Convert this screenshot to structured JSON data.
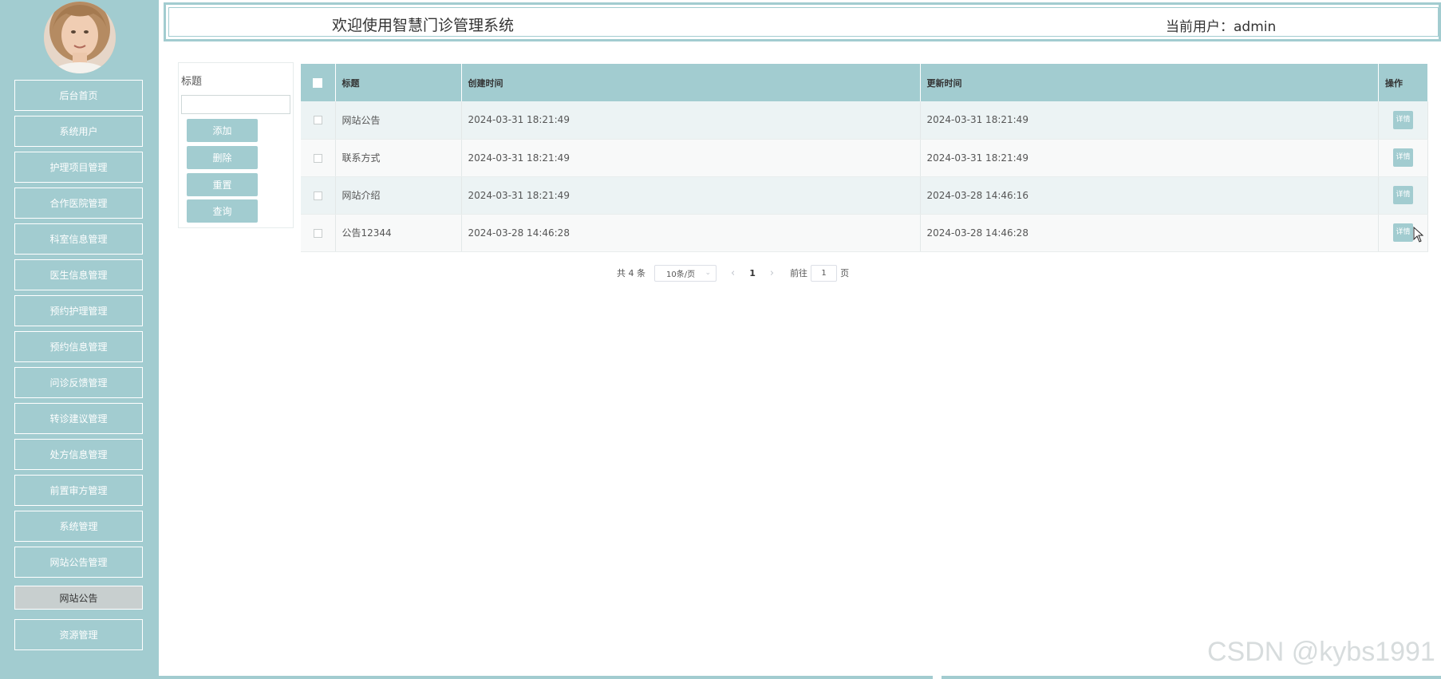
{
  "header": {
    "title": "欢迎使用智慧门诊管理系统",
    "current_user": "当前用户：admin"
  },
  "sidebar": {
    "items": [
      {
        "label": "后台首页"
      },
      {
        "label": "系统用户"
      },
      {
        "label": "护理项目管理"
      },
      {
        "label": "合作医院管理"
      },
      {
        "label": "科室信息管理"
      },
      {
        "label": "医生信息管理"
      },
      {
        "label": "预约护理管理"
      },
      {
        "label": "预约信息管理"
      },
      {
        "label": "问诊反馈管理"
      },
      {
        "label": "转诊建议管理"
      },
      {
        "label": "处方信息管理"
      },
      {
        "label": "前置审方管理"
      },
      {
        "label": "系统管理"
      },
      {
        "label": "网站公告管理"
      },
      {
        "label": "网站公告",
        "active": true
      },
      {
        "label": "资源管理"
      }
    ]
  },
  "search": {
    "label": "标题",
    "value": "",
    "buttons": {
      "add": "添加",
      "delete": "删除",
      "reset": "重置",
      "query": "查询"
    }
  },
  "table": {
    "headers": {
      "title": "标题",
      "created": "创建时间",
      "updated": "更新时间",
      "ops": "操作"
    },
    "rows": [
      {
        "title": "网站公告",
        "created": "2024-03-31 18:21:49",
        "updated": "2024-03-31 18:21:49",
        "action": "详情"
      },
      {
        "title": "联系方式",
        "created": "2024-03-31 18:21:49",
        "updated": "2024-03-31 18:21:49",
        "action": "详情"
      },
      {
        "title": "网站介绍",
        "created": "2024-03-31 18:21:49",
        "updated": "2024-03-28 14:46:16",
        "action": "详情"
      },
      {
        "title": "公告12344",
        "created": "2024-03-28 14:46:28",
        "updated": "2024-03-28 14:46:28",
        "action": "详情"
      }
    ]
  },
  "pagination": {
    "total": "共 4 条",
    "page_size": "10条/页",
    "current_page": "1",
    "goto_label": "前往",
    "goto_value": "1",
    "page_suffix": "页"
  },
  "watermark": "CSDN @kybs1991",
  "colors": {
    "accent": "#a2ccd0",
    "row_alt": "#ecf3f4"
  }
}
